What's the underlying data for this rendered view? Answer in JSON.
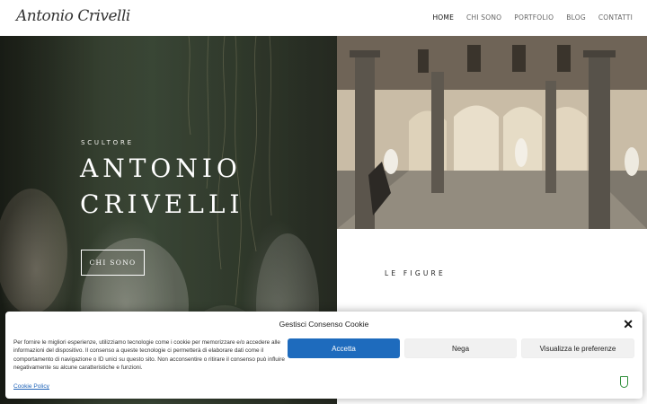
{
  "header": {
    "logo_text": "Antonio Crivelli",
    "nav": [
      {
        "label": "HOME"
      },
      {
        "label": "CHI SONO"
      },
      {
        "label": "PORTFOLIO"
      },
      {
        "label": "BLOG"
      },
      {
        "label": "CONTATTI"
      }
    ]
  },
  "hero": {
    "eyebrow": "SCULTORE",
    "title_line1": "ANTONIO",
    "title_line2": "CRIVELLI",
    "button_label": "CHI SONO"
  },
  "figure_section": {
    "heading": "LE FIGURE"
  },
  "cookie": {
    "title": "Gestisci Consenso Cookie",
    "text": "Per fornire le migliori esperienze, utilizziamo tecnologie come i cookie per memorizzare e/o accedere alle informazioni del dispositivo. Il consenso a queste tecnologie ci permetterà di elaborare dati come il comportamento di navigazione o ID unici su questo sito. Non acconsentire o ritirare il consenso può influire negativamente su alcune caratteristiche e funzioni.",
    "accept_label": "Accetta",
    "deny_label": "Nega",
    "prefs_label": "Visualizza le preferenze",
    "policy_link": "Cookie Policy",
    "close_icon": "close-icon"
  },
  "colors": {
    "accent": "#1e6bbd",
    "hero_dark": "#3a4433",
    "shield": "#2f8f3a"
  }
}
